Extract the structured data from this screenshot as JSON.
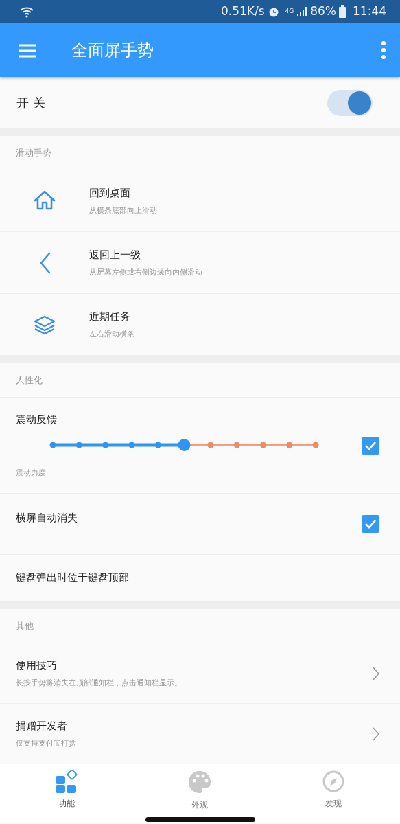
{
  "status_bar": {
    "speed": "0.51K/s",
    "network": "4G",
    "battery": "86%",
    "time": "11:44"
  },
  "app_bar": {
    "title": "全面屏手势"
  },
  "master_switch": {
    "label": "开 关",
    "on": true
  },
  "sections": [
    {
      "header": "滑动手势",
      "items": [
        {
          "kind": "gesture",
          "title": "回到桌面",
          "subtitle": "从横条底部向上滑动"
        },
        {
          "kind": "gesture",
          "title": "返回上一级",
          "subtitle": "从屏幕左侧或右侧边缘向内侧滑动"
        },
        {
          "kind": "gesture",
          "title": "近期任务",
          "subtitle": "左右滑动横条"
        }
      ]
    },
    {
      "header": "人性化",
      "items": [
        {
          "kind": "slider",
          "title": "震动反馈",
          "subtitle": "震动力度",
          "level": 0.5,
          "checked": true
        },
        {
          "kind": "checkbox",
          "title": "横屏自动消失",
          "checked": true
        },
        {
          "kind": "plain",
          "title": "键盘弹出时位于键盘顶部"
        }
      ]
    },
    {
      "header": "其他",
      "items": [
        {
          "kind": "link",
          "title": "使用技巧",
          "subtitle": "长按手势将消失在顶部通知栏，点击通知栏显示。"
        },
        {
          "kind": "link",
          "title": "捐赠开发者",
          "subtitle": "仅支持支付宝打赏"
        }
      ]
    }
  ],
  "bottom_nav": [
    {
      "label": "功能",
      "selected": true
    },
    {
      "label": "外观",
      "selected": false
    },
    {
      "label": "发现",
      "selected": false
    }
  ]
}
